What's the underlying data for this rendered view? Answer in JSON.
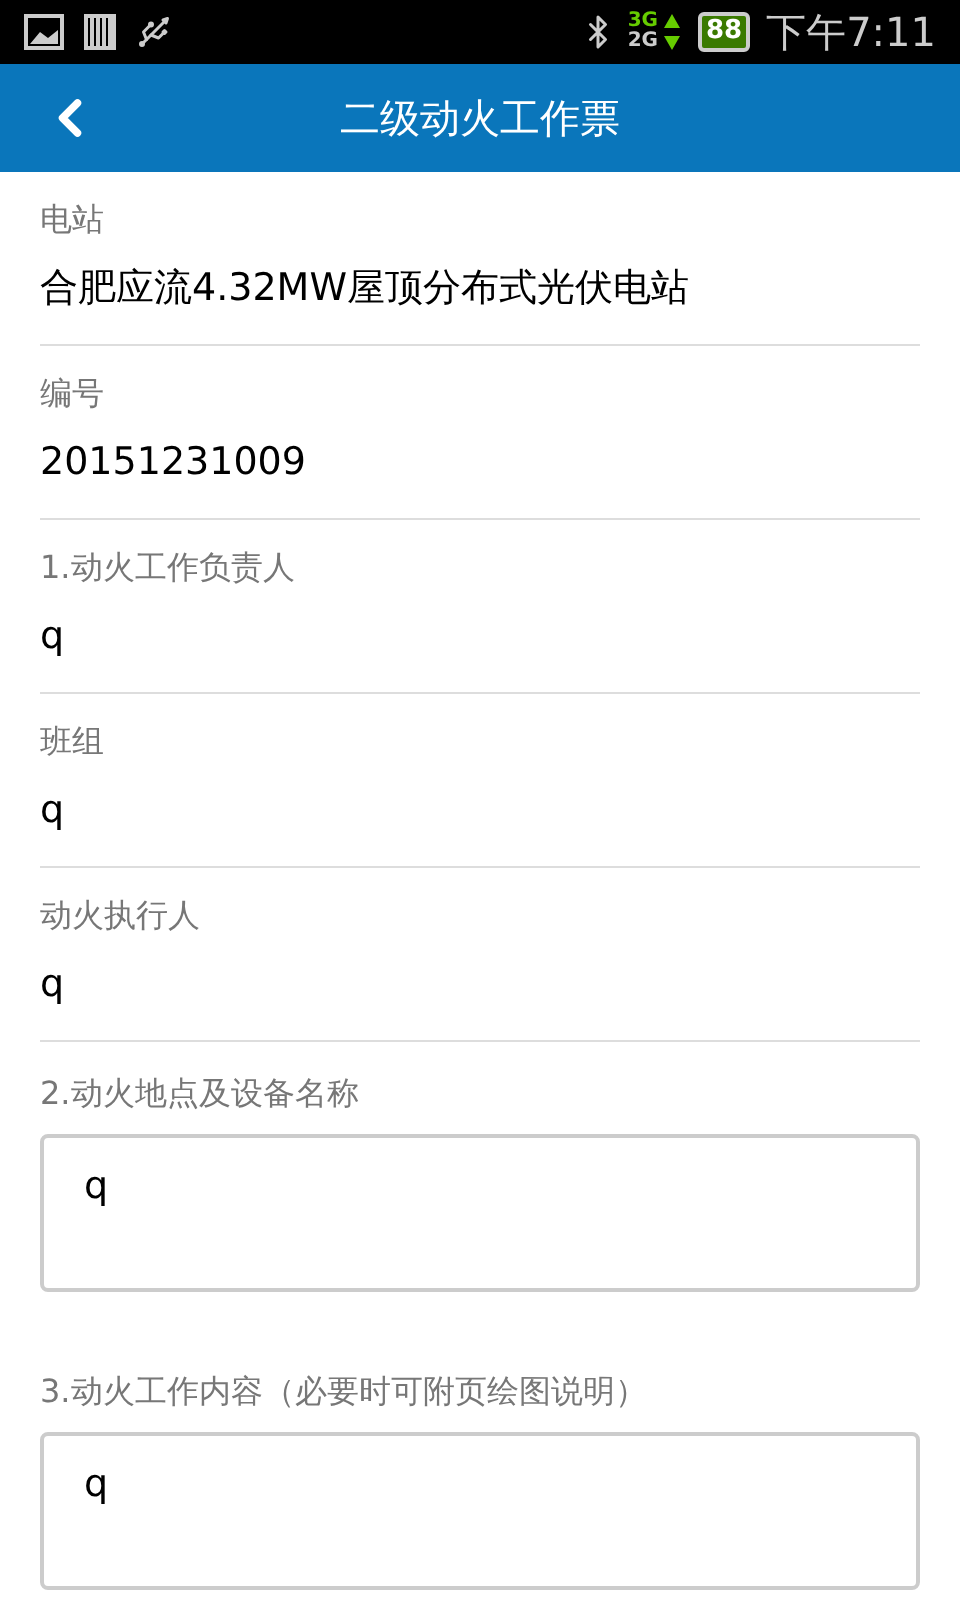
{
  "status_bar": {
    "network_top": "3G",
    "network_bottom": "2G",
    "battery": "88",
    "time": "下午7:11"
  },
  "header": {
    "title": "二级动火工作票"
  },
  "fields": [
    {
      "kind": "line",
      "label": "电站",
      "value": "合肥应流4.32MW屋顶分布式光伏电站"
    },
    {
      "kind": "line",
      "label": "编号",
      "value": "20151231009"
    },
    {
      "kind": "line",
      "label": "1.动火工作负责人",
      "value": "q"
    },
    {
      "kind": "line",
      "label": "班组",
      "value": "q"
    },
    {
      "kind": "line",
      "label": "动火执行人",
      "value": "q"
    },
    {
      "kind": "area",
      "label": "2.动火地点及设备名称",
      "value": "q"
    },
    {
      "kind": "area",
      "label": "3.动火工作内容（必要时可附页绘图说明）",
      "value": "q"
    }
  ]
}
